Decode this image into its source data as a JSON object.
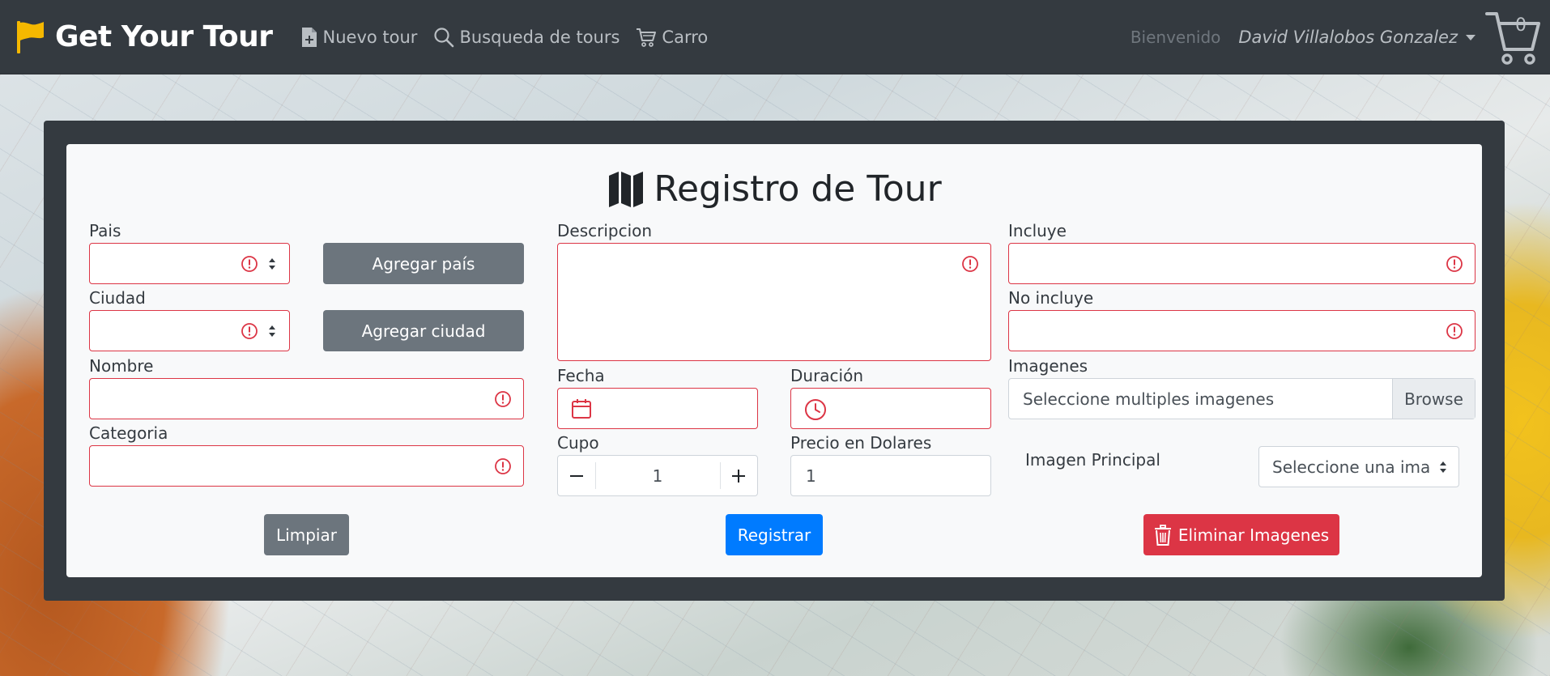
{
  "nav": {
    "brand": "Get Your Tour",
    "links": [
      {
        "label": "Nuevo tour",
        "icon": "file-plus-icon"
      },
      {
        "label": "Busqueda de tours",
        "icon": "search-icon"
      },
      {
        "label": "Carro",
        "icon": "cart-icon"
      }
    ],
    "welcome": "Bienvenido",
    "user": "David Villalobos Gonzalez",
    "cart_count": "0"
  },
  "form": {
    "title": "Registro de Tour",
    "pais_label": "Pais",
    "ciudad_label": "Ciudad",
    "nombre_label": "Nombre",
    "categoria_label": "Categoria",
    "descripcion_label": "Descripcion",
    "fecha_label": "Fecha",
    "duracion_label": "Duración",
    "cupo_label": "Cupo",
    "cupo_value": "1",
    "precio_label": "Precio en Dolares",
    "precio_value": "1",
    "incluye_label": "Incluye",
    "no_incluye_label": "No incluye",
    "imagenes_label": "Imagenes",
    "imagenes_placeholder": "Seleccione multiples imagenes",
    "browse_label": "Browse",
    "imagen_principal_label": "Imagen Principal",
    "imagen_principal_value": "Seleccione una imagen"
  },
  "buttons": {
    "agregar_pais": "Agregar país",
    "agregar_ciudad": "Agregar ciudad",
    "limpiar": "Limpiar",
    "registrar": "Registrar",
    "eliminar_imagenes": "Eliminar Imagenes"
  },
  "colors": {
    "navbar": "#343a40",
    "error": "#dc3545",
    "primary": "#007bff",
    "secondary": "#6c757d",
    "brand_flag": "#f5b800"
  }
}
